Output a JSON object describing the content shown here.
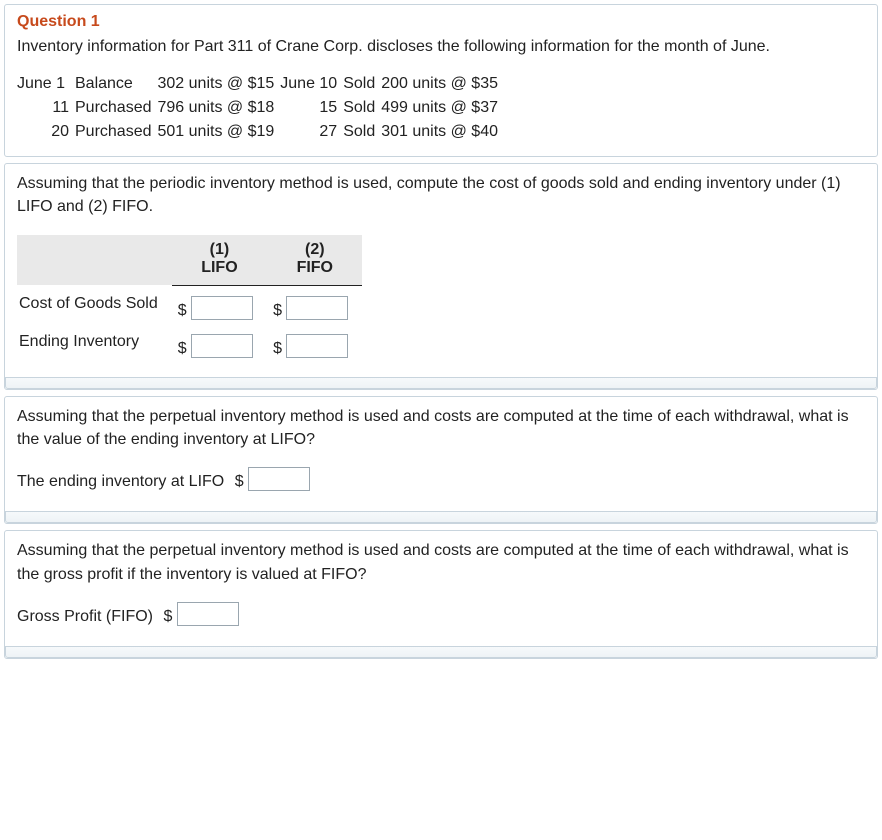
{
  "question": {
    "heading": "Question 1",
    "intro": "Inventory information for Part 311 of Crane Corp. discloses the following information for the month of June.",
    "rows": [
      {
        "ldate": "June 1",
        "lword": "Balance",
        "lqty": "302 units @ $15",
        "rdate": "June 10",
        "rword": "Sold",
        "rqty": "200 units @ $35"
      },
      {
        "ldate": "11",
        "lword": "Purchased",
        "lqty": "796 units @ $18",
        "rdate": "15",
        "rword": "Sold",
        "rqty": "499 units @ $37"
      },
      {
        "ldate": "20",
        "lword": "Purchased",
        "lqty": "501 units @ $19",
        "rdate": "27",
        "rword": "Sold",
        "rqty": "301 units @ $40"
      }
    ]
  },
  "part_a": {
    "prompt": "Assuming that the periodic inventory method is used, compute the cost of goods sold and ending inventory under (1) LIFO and (2) FIFO.",
    "col1_num": "(1)",
    "col1_name": "LIFO",
    "col2_num": "(2)",
    "col2_name": "FIFO",
    "row1_label": "Cost of Goods Sold",
    "row2_label": "Ending Inventory",
    "currency": "$"
  },
  "part_b": {
    "prompt": "Assuming that the perpetual inventory method is used and costs are computed at the time of each withdrawal, what is the value of the ending inventory at LIFO?",
    "label": "The ending inventory at LIFO",
    "currency": "$"
  },
  "part_c": {
    "prompt": "Assuming that the perpetual inventory method is used and costs are computed at the time of each withdrawal, what is the gross profit if the inventory is valued at FIFO?",
    "label": "Gross Profit (FIFO)",
    "currency": "$"
  }
}
